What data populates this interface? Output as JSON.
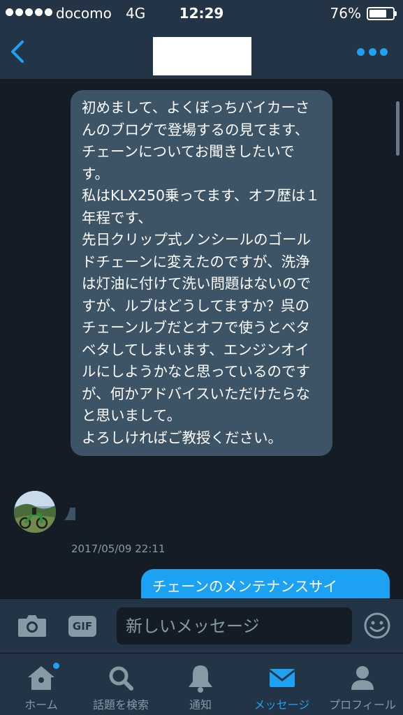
{
  "status_bar": {
    "carrier": "docomo",
    "network": "4G",
    "time": "12:29",
    "battery_percent": "76%",
    "battery_level": 0.76
  },
  "header": {
    "back_icon": "chevron-left-icon",
    "more_icon": "more-dots-icon",
    "accent_color": "#1da1f2"
  },
  "messages": [
    {
      "direction": "incoming",
      "text": "初めまして、よくぼっちバイカーさんのブログで登場するの見てます、チェーンについてお聞きしたいです。\n私はKLX250乗ってます、オフ歴は１年程です、\n先日クリップ式ノンシールのゴールドチェーンに変えたのですが、洗浄は灯油に付けて洗い問題はないのですが、ルブはどうしてますか？呉のチェーンルブだとオフで使うとベタベタしてしまいます、エンジンオイルにしようかなと思っているのですが、何かアドバイスいただけたらなと思いまして。\nよろしければご教授ください。",
      "timestamp": "2017/05/09 22:11"
    },
    {
      "direction": "outgoing",
      "text": "チェーンのメンテナンスサイ"
    }
  ],
  "compose": {
    "placeholder": "新しいメッセージ",
    "gif_label": "GIF"
  },
  "tabs": [
    {
      "label": "ホーム",
      "icon": "home-icon",
      "active": false
    },
    {
      "label": "話題を検索",
      "icon": "search-icon",
      "active": false
    },
    {
      "label": "通知",
      "icon": "bell-icon",
      "active": false
    },
    {
      "label": "メッセージ",
      "icon": "mail-icon",
      "active": true
    },
    {
      "label": "プロフィール",
      "icon": "profile-icon",
      "active": false
    }
  ],
  "colors": {
    "background": "#141d26",
    "bar": "#243447",
    "bubble_incoming": "#3d5466",
    "bubble_outgoing": "#1da1f2",
    "muted": "#8899a6"
  }
}
